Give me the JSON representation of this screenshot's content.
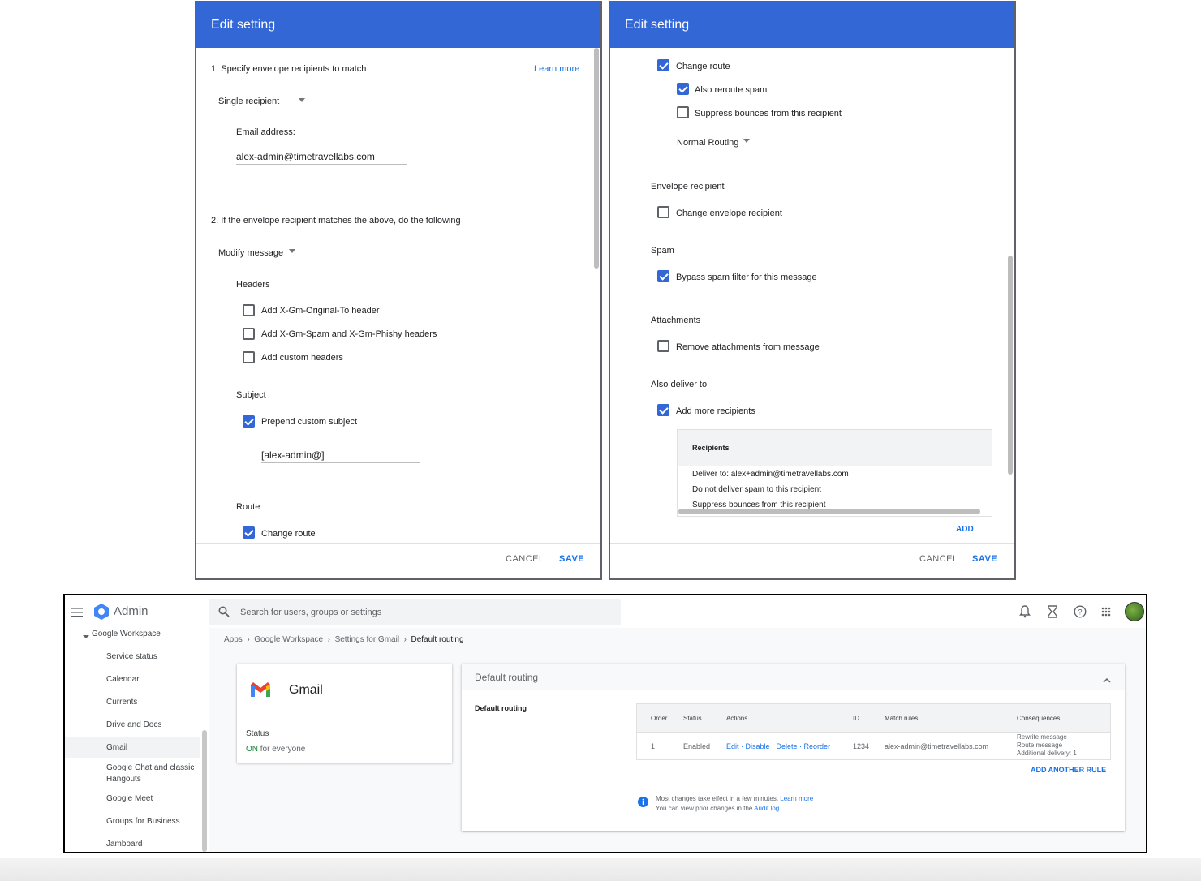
{
  "dialog_left": {
    "title": "Edit setting",
    "step1": "1. Specify envelope recipients to match",
    "learn_more": "Learn more",
    "recipient_type": "Single recipient",
    "email_label": "Email address:",
    "email_value": "alex-admin@timetravellabs.com",
    "step2": "2. If the envelope recipient matches the above, do the following",
    "action_type": "Modify message",
    "headers_label": "Headers",
    "headers_opt1": "Add X-Gm-Original-To header",
    "headers_opt2": "Add X-Gm-Spam and X-Gm-Phishy headers",
    "headers_opt3": "Add custom headers",
    "subject_label": "Subject",
    "subject_opt": "Prepend custom subject",
    "subject_value": "[alex-admin@]",
    "route_label": "Route",
    "route_opt": "Change route",
    "cancel": "CANCEL",
    "save": "SAVE"
  },
  "dialog_right": {
    "title": "Edit setting",
    "change_route": "Change route",
    "reroute_spam": "Also reroute spam",
    "suppress_bounces": "Suppress bounces from this recipient",
    "routing": "Normal Routing",
    "envelope_label": "Envelope recipient",
    "envelope_opt": "Change envelope recipient",
    "spam_label": "Spam",
    "spam_opt": "Bypass spam filter for this message",
    "attach_label": "Attachments",
    "attach_opt": "Remove attachments from message",
    "deliver_label": "Also deliver to",
    "deliver_opt": "Add more recipients",
    "recipients_header": "Recipients",
    "recipients_rows": [
      "Deliver to: alex+admin@timetravellabs.com",
      "Do not deliver spam to this recipient",
      "Suppress bounces from this recipient"
    ],
    "add": "ADD",
    "cancel": "CANCEL",
    "save": "SAVE"
  },
  "admin": {
    "app_name": "Admin",
    "search_placeholder": "Search for users, groups or settings",
    "sidebar": {
      "group": "Google Workspace",
      "items": [
        "Service status",
        "Calendar",
        "Currents",
        "Drive and Docs",
        "Gmail",
        "Google Chat and classic Hangouts",
        "Google Meet",
        "Groups for Business",
        "Jamboard"
      ]
    },
    "breadcrumb": [
      "Apps",
      "Google Workspace",
      "Settings for Gmail",
      "Default routing"
    ],
    "gmail_card": {
      "title": "Gmail",
      "status_label": "Status",
      "status_on": "ON",
      "status_rest": "for everyone"
    },
    "routing_panel": {
      "title": "Default routing",
      "section_label": "Default routing",
      "columns": [
        "Order",
        "Status",
        "Actions",
        "ID",
        "Match rules",
        "Consequences"
      ],
      "row": {
        "order": "1",
        "status": "Enabled",
        "actions": [
          "Edit",
          "Disable",
          "Delete",
          "Reorder"
        ],
        "id": "1234",
        "match": "alex-admin@timetravellabs.com",
        "consequences": [
          "Rewrite message",
          "Route message",
          "Additional delivery: 1"
        ]
      },
      "add_rule": "ADD ANOTHER RULE",
      "info_line1": "Most changes take effect in a few minutes.",
      "info_link1": "Learn more",
      "info_line2": "You can view prior changes in the",
      "info_link2": "Audit log"
    }
  },
  "colors": {
    "header_blue": "#3367d6",
    "link_blue": "#1a73e8",
    "on_green": "#188038"
  }
}
